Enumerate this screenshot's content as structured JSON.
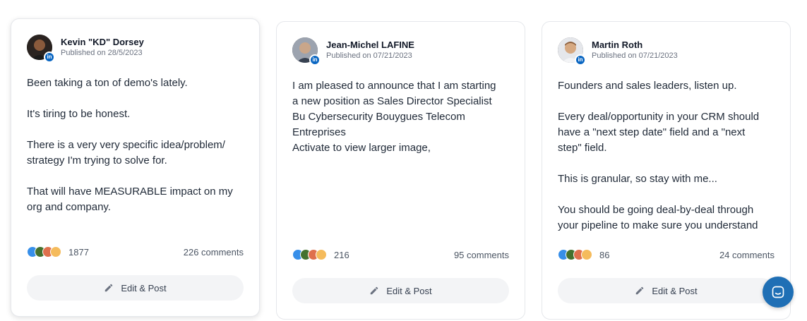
{
  "posts": [
    {
      "author": "Kevin \"KD\" Dorsey",
      "published": "Published on 28/5/2023",
      "text": "Been taking a ton of demo's lately.\n\nIt's tiring to be honest.\n\nThere is a very very specific idea/problem/\nstrategy I'm trying to solve for.\n\nThat will have MEASURABLE impact on my\norg and company.",
      "reactions": "1877",
      "comments": "226 comments",
      "edit_label": "Edit & Post"
    },
    {
      "author": "Jean-Michel LAFINE",
      "published": "Published on 07/21/2023",
      "text": "I am pleased to announce that I am starting\na new position as Sales Director Specialist\nBu Cybersecurity Bouygues Telecom\nEntreprises\nActivate to view larger image,",
      "reactions": "216",
      "comments": "95 comments",
      "edit_label": "Edit & Post"
    },
    {
      "author": "Martin Roth",
      "published": "Published on 07/21/2023",
      "text": "Founders and sales leaders, listen up.\n\nEvery deal/opportunity in your CRM should\nhave a \"next step date\" field and a \"next\nstep\" field.\n\nThis is granular, so stay with me...\n\nYou should be going deal-by-deal through\nyour pipeline to make sure you understand",
      "reactions": "86",
      "comments": "24 comments",
      "edit_label": "Edit & Post"
    }
  ],
  "badge_label": "in",
  "icons": {
    "linkedin_badge": "linkedin-icon",
    "edit": "pencil-icon",
    "chat": "chat-icon"
  },
  "colors": {
    "linkedin_blue": "#0a66c2",
    "chat_launcher": "#1f6fb5"
  }
}
